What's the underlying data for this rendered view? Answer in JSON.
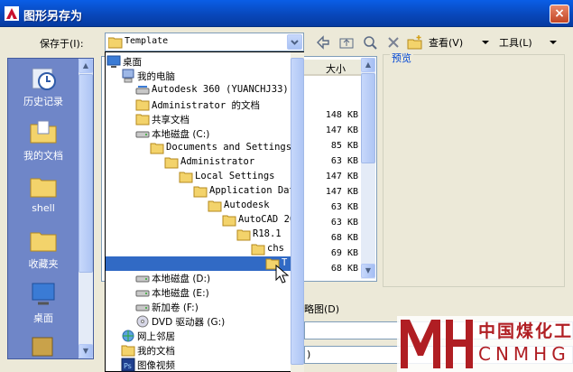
{
  "window": {
    "title": "图形另存为",
    "close_glyph": "×"
  },
  "toolbar": {
    "save_in_label": "保存于(I):",
    "current_folder": "Template",
    "views_label": "查看(V)",
    "tools_label": "工具(L)"
  },
  "places": [
    {
      "label": "历史记录",
      "icon": "history-icon"
    },
    {
      "label": "我的文档",
      "icon": "my-documents-icon"
    },
    {
      "label": "shell",
      "icon": "folder-icon"
    },
    {
      "label": "收藏夹",
      "icon": "favorites-icon"
    },
    {
      "label": "桌面",
      "icon": "desktop-icon"
    }
  ],
  "file_list": {
    "size_header": "大小",
    "sizes": [
      "148 KB",
      "147 KB",
      "85 KB",
      "63 KB",
      "147 KB",
      "147 KB",
      "63 KB",
      "63 KB",
      "68 KB",
      "69 KB",
      "68 KB"
    ]
  },
  "preview": {
    "label": "预览"
  },
  "bottom": {
    "partial_label": "略图(D)",
    "partial_field_text": ")"
  },
  "dropdown_tree": [
    {
      "label": "桌面",
      "icon": "desktop-icon"
    },
    {
      "label": "我的电脑",
      "icon": "computer-icon"
    },
    {
      "label": "Autodesk 360 (YUANCHJ33)",
      "icon": "network-drive-icon"
    },
    {
      "label": "Administrator 的文档",
      "icon": "folder-icon"
    },
    {
      "label": "共享文档",
      "icon": "folder-icon"
    },
    {
      "label": "本地磁盘 (C:)",
      "icon": "disk-icon"
    },
    {
      "label": "Documents and Settings",
      "icon": "folder-icon"
    },
    {
      "label": "Administrator",
      "icon": "folder-icon"
    },
    {
      "label": "Local Settings",
      "icon": "folder-icon"
    },
    {
      "label": "Application Dat",
      "icon": "folder-icon"
    },
    {
      "label": "Autodesk",
      "icon": "folder-icon"
    },
    {
      "label": "AutoCAD 20",
      "icon": "folder-icon"
    },
    {
      "label": "R18.1",
      "icon": "folder-icon"
    },
    {
      "label": "chs",
      "icon": "folder-icon"
    },
    {
      "label": "T",
      "icon": "folder-open-icon"
    },
    {
      "label": "本地磁盘 (D:)",
      "icon": "disk-icon"
    },
    {
      "label": "本地磁盘 (E:)",
      "icon": "disk-icon"
    },
    {
      "label": "新加卷 (F:)",
      "icon": "disk-icon"
    },
    {
      "label": "DVD 驱动器 (G:)",
      "icon": "dvd-icon"
    },
    {
      "label": "网上邻居",
      "icon": "network-icon"
    },
    {
      "label": "我的文档",
      "icon": "my-documents-icon"
    },
    {
      "label": "图像视频",
      "icon": "photoshop-icon"
    }
  ],
  "watermark": {
    "chinese": "中国煤化工",
    "english": "CNMHG"
  },
  "colors": {
    "title_bar": "#0846B8",
    "selection": "#316AC5",
    "places_bar": "#6F86C8",
    "watermark": "#B01E23"
  }
}
